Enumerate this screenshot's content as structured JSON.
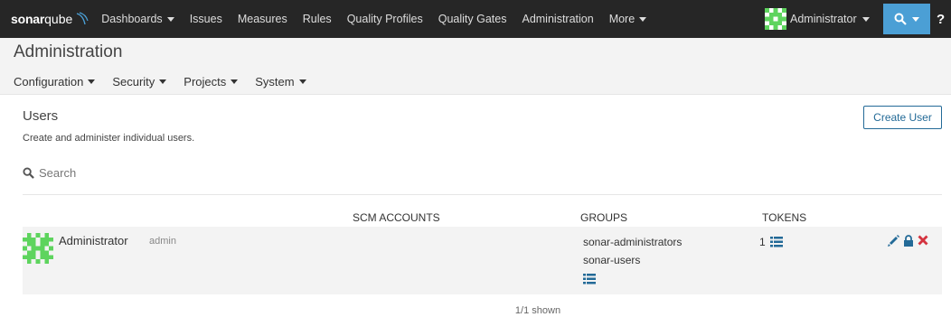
{
  "brand": {
    "word1": "sonar",
    "word2": "qube"
  },
  "topnav": {
    "items": [
      {
        "label": "Dashboards",
        "dropdown": true
      },
      {
        "label": "Issues",
        "dropdown": false
      },
      {
        "label": "Measures",
        "dropdown": false
      },
      {
        "label": "Rules",
        "dropdown": false
      },
      {
        "label": "Quality Profiles",
        "dropdown": false
      },
      {
        "label": "Quality Gates",
        "dropdown": false
      },
      {
        "label": "Administration",
        "dropdown": false
      },
      {
        "label": "More",
        "dropdown": true
      }
    ],
    "user": "Administrator",
    "help": "?"
  },
  "admin": {
    "title": "Administration",
    "submenu": [
      "Configuration",
      "Security",
      "Projects",
      "System"
    ]
  },
  "page": {
    "title": "Users",
    "description": "Create and administer individual users.",
    "create_button": "Create User",
    "search_placeholder": "Search"
  },
  "table": {
    "headers": {
      "scm": "SCM ACCOUNTS",
      "groups": "GROUPS",
      "tokens": "TOKENS"
    },
    "rows": [
      {
        "name": "Administrator",
        "login": "admin",
        "groups": [
          "sonar-administrators",
          "sonar-users"
        ],
        "tokens": "1"
      }
    ]
  },
  "footer": {
    "shown": "1/1 shown"
  },
  "colors": {
    "accent": "#4b9fd5",
    "topbar": "#262626",
    "danger": "#d4333f",
    "link": "#236a97",
    "avatar": "#5ed45e"
  },
  "icons": [
    "search-icon",
    "help-icon",
    "list-icon",
    "pencil-icon",
    "lock-icon",
    "delete-icon"
  ]
}
